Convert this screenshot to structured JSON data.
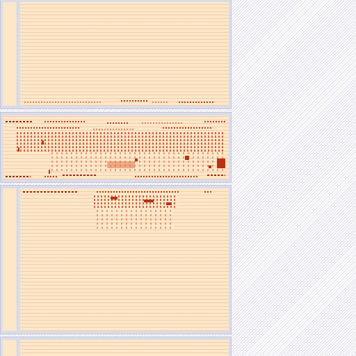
{
  "app": {
    "title": "",
    "panels": [
      {
        "kind": "code-view",
        "text_legible": false
      },
      {
        "kind": "code-view",
        "text_legible": false
      },
      {
        "kind": "code-view",
        "text_legible": false
      },
      {
        "kind": "code-view",
        "text_legible": false
      }
    ]
  },
  "colors": {
    "panel_background": "#fde7c9",
    "panel_frame": "#dadcea",
    "text_accent": "#c0391b",
    "desktop_pattern": "#d9d9e3"
  }
}
